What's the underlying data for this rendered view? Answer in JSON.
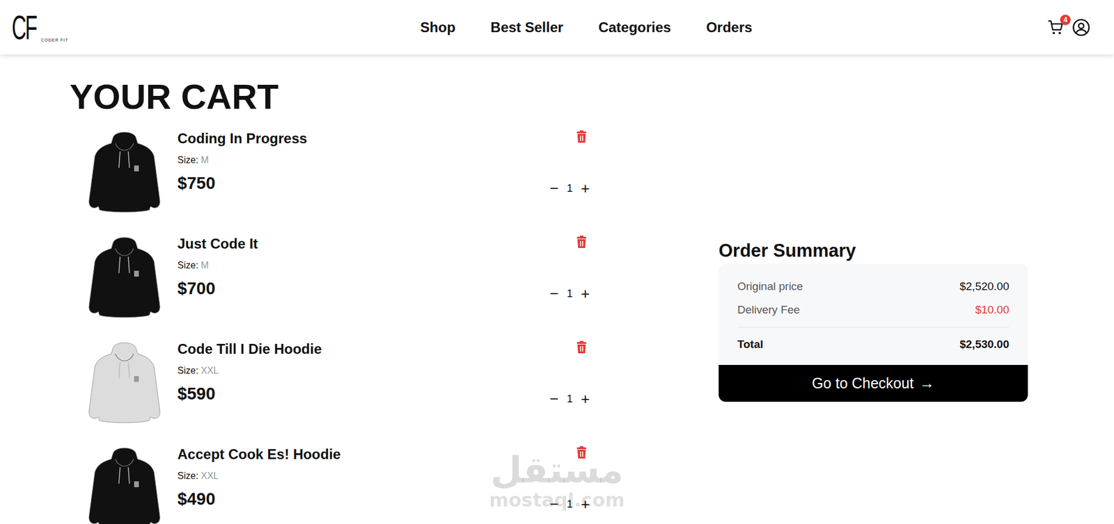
{
  "header": {
    "logo": {
      "mark": "CF",
      "subtitle": "CODER FIT"
    },
    "nav": [
      "Shop",
      "Best Seller",
      "Categories",
      "Orders"
    ],
    "cart_badge": "4"
  },
  "page_title": "YOUR CART",
  "qty_buttons": {
    "minus": "−",
    "plus": "+"
  },
  "items": [
    {
      "name": "Coding In Progress",
      "size_label": "Size:",
      "size": "M",
      "price": "$750",
      "quantity": "1",
      "color": "#111111"
    },
    {
      "name": "Just Code It",
      "size_label": "Size:",
      "size": "M",
      "price": "$700",
      "quantity": "1",
      "color": "#111111"
    },
    {
      "name": "Code Till I Die Hoodie",
      "size_label": "Size:",
      "size": "XXL",
      "price": "$590",
      "quantity": "1",
      "color": "#dcdcdc"
    },
    {
      "name": "Accept Cook Es! Hoodie",
      "size_label": "Size:",
      "size": "XXL",
      "price": "$490",
      "quantity": "1",
      "color": "#111111"
    }
  ],
  "summary": {
    "title": "Order Summary",
    "rows": [
      {
        "label": "Original price",
        "value": "$2,520.00",
        "color": "#111111"
      },
      {
        "label": "Delivery Fee",
        "value": "$10.00",
        "color": "#e53935"
      }
    ],
    "total": {
      "label": "Total",
      "value": "$2,530.00"
    },
    "checkout": "Go to Checkout",
    "arrow": "→"
  },
  "watermark": {
    "arabic": "مستقل",
    "latin": "mostaql.com"
  }
}
